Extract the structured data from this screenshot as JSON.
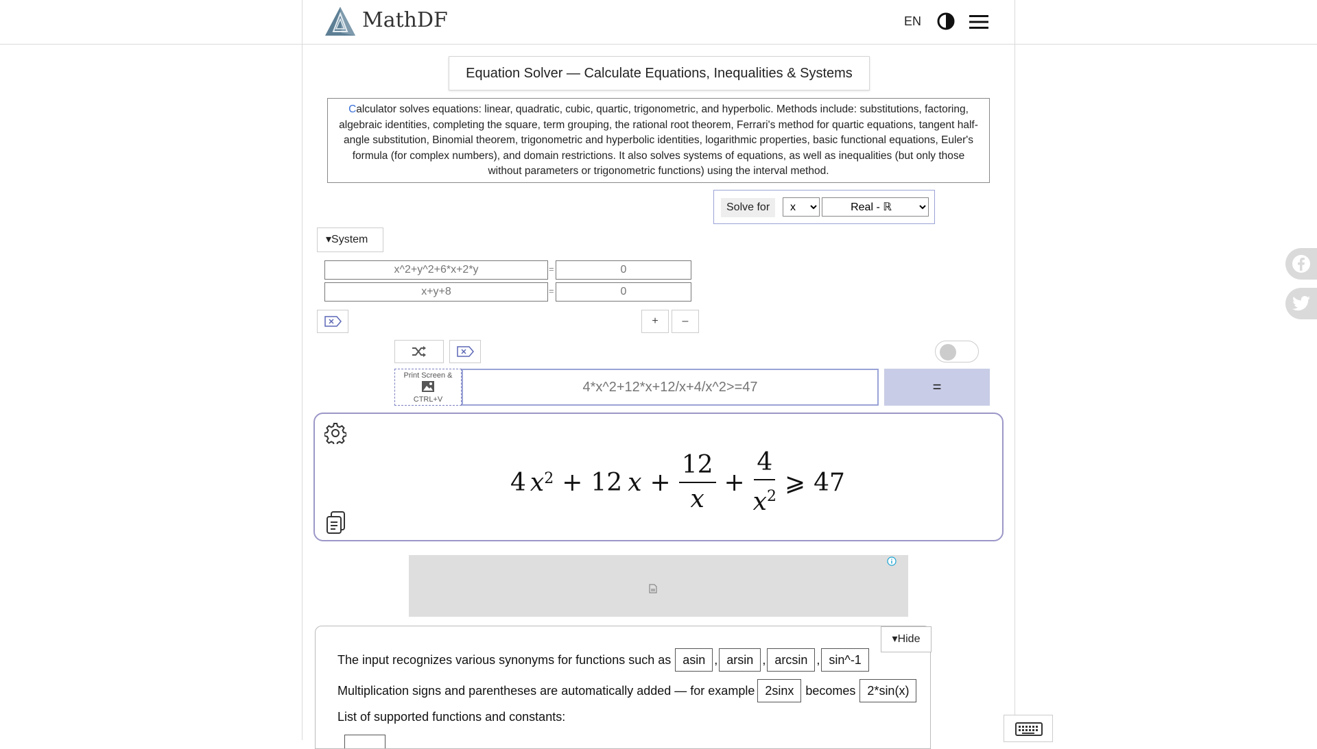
{
  "header": {
    "logo_text": "MathDF",
    "language": "EN"
  },
  "page": {
    "title": "Equation Solver — Calculate Equations, Inequalities & Systems",
    "description_first_letter": "C",
    "description_rest": "alculator solves equations: linear, quadratic, cubic, quartic, trigonometric, and hyperbolic. Methods include: substitutions, factoring, algebraic identities, completing the square, term grouping, the rational root theorem, Ferrari's method for quartic equations, tangent half-angle substitution, Binomial theorem, trigonometric and hyperbolic identities, logarithmic properties, basic functional equations, Euler's formula (for complex numbers), and domain restrictions. It also solves systems of equations, as well as inequalities (but only those without parameters or trigonometric functions) using the interval method."
  },
  "solve": {
    "label": "Solve for",
    "variable": "x",
    "domain": "Real - ℝ"
  },
  "system": {
    "toggle_label": "▾System",
    "equations": [
      {
        "left_placeholder": "x^2+y^2+6*x+2*y",
        "eq": "=",
        "right_placeholder": "0"
      },
      {
        "left_placeholder": "x+y+8",
        "eq": "=",
        "right_placeholder": "0"
      }
    ],
    "add_label": "+",
    "remove_label": "–"
  },
  "input": {
    "print_screen_line1": "Print Screen &",
    "print_screen_line2": "CTRL+V",
    "expression_placeholder": "4*x^2+12*x+12/x+4/x^2>=47",
    "equals_label": "="
  },
  "result": {
    "coef1": "4",
    "var1": "x",
    "exp1": "2",
    "plus1": "+",
    "coef2": "12",
    "var2": "x",
    "plus2": "+",
    "frac1_num": "12",
    "frac1_den": "x",
    "plus3": "+",
    "frac2_num": "4",
    "frac2_den_var": "x",
    "frac2_den_exp": "2",
    "relation": "⩾",
    "rhs": "47"
  },
  "info": {
    "hide_label": "▾Hide",
    "line1_text": "The input recognizes various synonyms for functions such as",
    "synonyms": [
      "asin",
      "arsin",
      "arcsin",
      "sin^-1"
    ],
    "line2_text": "Multiplication signs and parentheses are automatically added — for example",
    "line2_example": "2sinx",
    "line2_becomes": "becomes",
    "line2_result": "2*sin(x)",
    "line3_text": "List of supported functions and constants:"
  },
  "colors": {
    "accent": "#9aa3d6",
    "equals_button": "#c8cce6",
    "result_border": "#9b97c8",
    "link_blue": "#3a6fd8"
  },
  "icons": {
    "logo": "pyramid-logo-icon",
    "theme": "contrast-icon",
    "menu": "hamburger-icon",
    "clear": "clear-x-icon",
    "shuffle": "shuffle-icon",
    "settings": "gear-icon",
    "copy": "clipboard-icon",
    "facebook": "facebook-icon",
    "twitter": "twitter-icon",
    "keyboard": "keyboard-icon",
    "info": "info-icon"
  }
}
